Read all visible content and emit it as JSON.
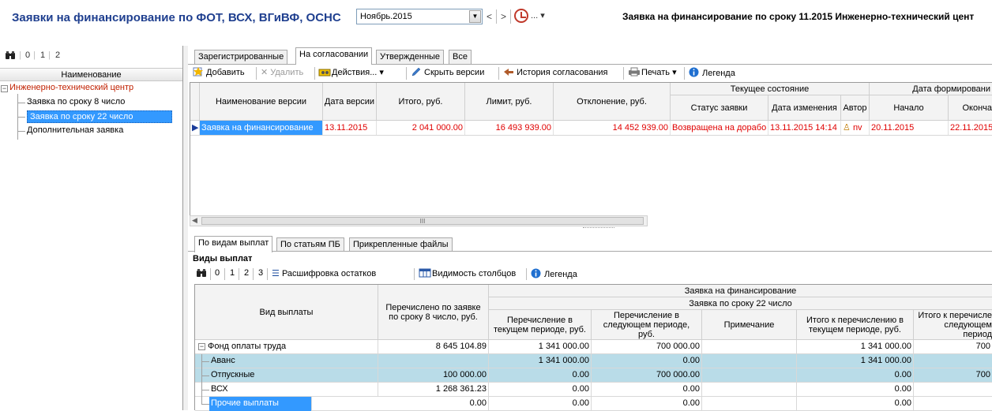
{
  "header": {
    "title": "Заявки на финансирование по ФОТ, ВСХ, ВГиВФ, ОСНС",
    "period_value": "Ноябрь.2015",
    "nav_prev": "<",
    "nav_next": ">",
    "more": "...",
    "right_title": "Заявка на финансирование по сроку 11.2015 Инженерно-технический цент"
  },
  "left": {
    "toolbar": [
      "0",
      "1",
      "2"
    ],
    "column_header": "Наименование",
    "tree": {
      "root": "Инженерно-технический центр",
      "children": [
        "Заявка по сроку 8 число",
        "Заявка по сроку 22 число",
        "Дополнительная заявка"
      ]
    }
  },
  "tabs": [
    "Зарегистрированные",
    "На согласовании",
    "Утвержденные",
    "Все"
  ],
  "toolbar": {
    "add": "Добавить",
    "delete": "Удалить",
    "actions": "Действия...",
    "hide_versions": "Скрыть версии",
    "history": "История согласования",
    "print": "Печать",
    "legend": "Легенда"
  },
  "grid1": {
    "headers": {
      "version_name": "Наименование версии",
      "version_date": "Дата версии",
      "total": "Итого, руб.",
      "limit": "Лимит, руб.",
      "deviation": "Отклонение, руб.",
      "current_state": "Текущее состояние",
      "status": "Статус заявки",
      "changed": "Дата изменения",
      "author": "Автор",
      "formation_date": "Дата формировани",
      "start": "Начало",
      "end": "Оконча"
    },
    "row": {
      "version_name": "Заявка на финансирование",
      "version_date": "13.11.2015",
      "total": "2 041 000.00",
      "limit": "16 493 939.00",
      "deviation": "14 452 939.00",
      "status": "Возвращена на дорабо",
      "changed": "13.11.2015 14:14",
      "author": "nv",
      "start": "20.11.2015",
      "end": "22.11.2015"
    },
    "scroll_mark": "III"
  },
  "bottom_tabs": [
    "По видам выплат",
    "По статьям ПБ",
    "Прикрепленные файлы"
  ],
  "section_title": "Виды выплат",
  "bottom_toolbar": {
    "levels": [
      "0",
      "1",
      "2",
      "3"
    ],
    "decode": "Расшифровка остатков",
    "visibility": "Видимость столбцов",
    "legend": "Легенда"
  },
  "grid2": {
    "headers": {
      "payment_type": "Вид выплаты",
      "transferred_8": "Перечислено по заявке по сроку 8 число, руб.",
      "request": "Заявка на финансирование",
      "request_22": "Заявка по сроку 22 число",
      "current_period": "Перечисление в текущем периоде, руб.",
      "next_period": "Перечисление в следующем периоде, руб.",
      "note": "Примечание",
      "total_current": "Итого к перечислению в текущем периоде, руб.",
      "total_next": "Итого к перечисле следующем период"
    },
    "rows": [
      {
        "name": "Фонд оплаты труда",
        "t8": "8 645 104.89",
        "cur": "1 341 000.00",
        "next": "700 000.00",
        "note": "",
        "tcur": "1 341 000.00",
        "tnext": "700"
      },
      {
        "name": "Аванс",
        "t8": "",
        "cur": "1 341 000.00",
        "next": "0.00",
        "note": "",
        "tcur": "1 341 000.00",
        "tnext": ""
      },
      {
        "name": "Отпускные",
        "t8": "100 000.00",
        "cur": "0.00",
        "next": "700 000.00",
        "note": "",
        "tcur": "0.00",
        "tnext": "700"
      },
      {
        "name": "ВСХ",
        "t8": "1 268 361.23",
        "cur": "0.00",
        "next": "0.00",
        "note": "",
        "tcur": "0.00",
        "tnext": ""
      },
      {
        "name": "Прочие выплаты",
        "t8": "0.00",
        "cur": "0.00",
        "next": "0.00",
        "note": "",
        "tcur": "0.00",
        "tnext": ""
      }
    ]
  },
  "colors": {
    "title_blue": "#1f3f8f",
    "selection_blue": "#3399ff",
    "row_highlight": "#b9dce8",
    "red_value": "#e00000"
  }
}
